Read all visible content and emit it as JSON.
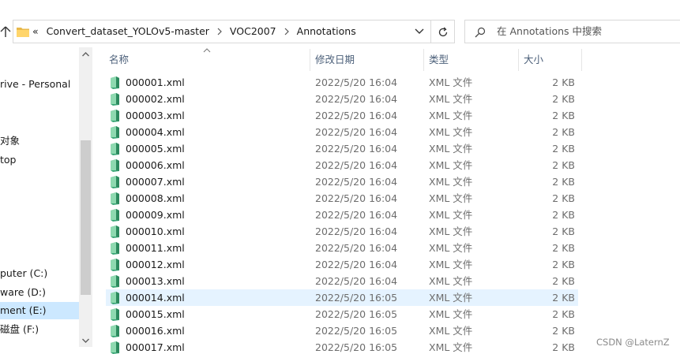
{
  "address": {
    "overflow_chevron": "«",
    "crumbs": [
      "Convert_dataset_YOLOv5-master",
      "VOC2007",
      "Annotations"
    ]
  },
  "search": {
    "placeholder": "在 Annotations 中搜索"
  },
  "navigation": {
    "items": [
      {
        "label": "rive - Personal",
        "selected": false
      },
      {
        "label": "对象",
        "selected": false
      },
      {
        "label": "top",
        "selected": false
      },
      {
        "label": "puter (C:)",
        "selected": false
      },
      {
        "label": "ware (D:)",
        "selected": false
      },
      {
        "label": "ment (E:)",
        "selected": true
      },
      {
        "label": "磁盘 (F:)",
        "selected": false
      }
    ]
  },
  "columns": {
    "name": "名称",
    "date": "修改日期",
    "type": "类型",
    "size": "大小"
  },
  "files": [
    {
      "name": "000001.xml",
      "date": "2022/5/20 16:04",
      "type": "XML 文件",
      "size": "2 KB"
    },
    {
      "name": "000002.xml",
      "date": "2022/5/20 16:04",
      "type": "XML 文件",
      "size": "2 KB"
    },
    {
      "name": "000003.xml",
      "date": "2022/5/20 16:04",
      "type": "XML 文件",
      "size": "2 KB"
    },
    {
      "name": "000004.xml",
      "date": "2022/5/20 16:04",
      "type": "XML 文件",
      "size": "2 KB"
    },
    {
      "name": "000005.xml",
      "date": "2022/5/20 16:04",
      "type": "XML 文件",
      "size": "2 KB"
    },
    {
      "name": "000006.xml",
      "date": "2022/5/20 16:04",
      "type": "XML 文件",
      "size": "2 KB"
    },
    {
      "name": "000007.xml",
      "date": "2022/5/20 16:04",
      "type": "XML 文件",
      "size": "2 KB"
    },
    {
      "name": "000008.xml",
      "date": "2022/5/20 16:04",
      "type": "XML 文件",
      "size": "2 KB"
    },
    {
      "name": "000009.xml",
      "date": "2022/5/20 16:04",
      "type": "XML 文件",
      "size": "2 KB"
    },
    {
      "name": "000010.xml",
      "date": "2022/5/20 16:04",
      "type": "XML 文件",
      "size": "2 KB"
    },
    {
      "name": "000011.xml",
      "date": "2022/5/20 16:04",
      "type": "XML 文件",
      "size": "2 KB"
    },
    {
      "name": "000012.xml",
      "date": "2022/5/20 16:04",
      "type": "XML 文件",
      "size": "2 KB"
    },
    {
      "name": "000013.xml",
      "date": "2022/5/20 16:04",
      "type": "XML 文件",
      "size": "2 KB"
    },
    {
      "name": "000014.xml",
      "date": "2022/5/20 16:05",
      "type": "XML 文件",
      "size": "2 KB",
      "hover": true
    },
    {
      "name": "000015.xml",
      "date": "2022/5/20 16:05",
      "type": "XML 文件",
      "size": "2 KB"
    },
    {
      "name": "000016.xml",
      "date": "2022/5/20 16:05",
      "type": "XML 文件",
      "size": "2 KB"
    },
    {
      "name": "000017.xml",
      "date": "2022/5/20 16:05",
      "type": "XML 文件",
      "size": "2 KB"
    }
  ],
  "watermark": "CSDN @LaternZ",
  "colors": {
    "selection": "#cce8ff",
    "hover": "#e5f3ff",
    "header_text": "#4c607a",
    "xml_icon": "#3aa676"
  }
}
